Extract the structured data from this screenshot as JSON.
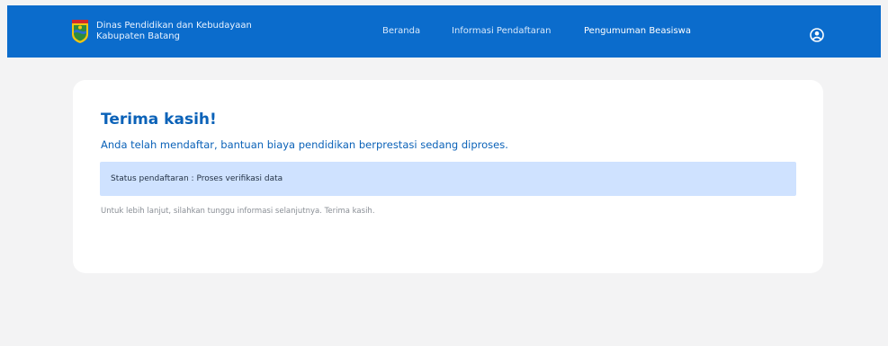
{
  "header": {
    "brand_line1": "Dinas Pendidikan dan Kebudayaan",
    "brand_line2": "Kabupaten Batang",
    "logo_icon": "batang-regency-emblem",
    "nav": [
      {
        "label": "Beranda"
      },
      {
        "label": "Informasi Pendaftaran"
      },
      {
        "label": "Pengumuman Beasiswa"
      }
    ],
    "profile_icon": "user-circle-icon",
    "colors": {
      "bar": "#0b6ccc",
      "text": "#ffffff"
    }
  },
  "main": {
    "title": "Terima kasih!",
    "subtitle": "Anda telah mendaftar, bantuan biaya pendidikan berprestasi sedang diproses.",
    "status_text": "Status pendaftaran : Proses verifikasi data",
    "note": "Untuk lebih lanjut, silahkan tunggu informasi selanjutnya. Terima kasih.",
    "colors": {
      "heading": "#0b62b8",
      "status_bg": "#cfe2ff",
      "page_bg": "#f3f3f4"
    }
  }
}
